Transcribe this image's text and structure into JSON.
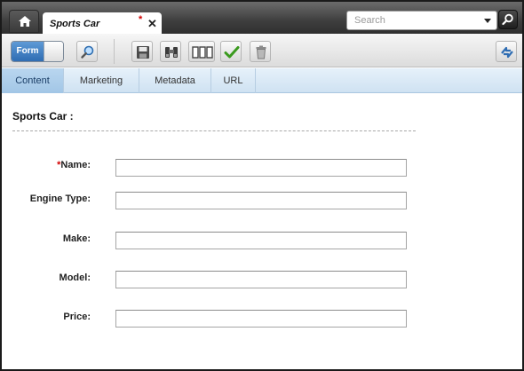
{
  "window": {
    "doc_tab_title": "Sports Car",
    "dirty_marker": "*",
    "close_glyph": "✕"
  },
  "search": {
    "placeholder": "Search",
    "value": ""
  },
  "toolbar": {
    "mode_toggle_label": "Form",
    "buttons": [
      "search-icon",
      "save-icon",
      "compare-icon",
      "columns-icon",
      "checkmark-icon",
      "trash-icon",
      "sync-icon"
    ]
  },
  "tabs": [
    {
      "label": "Content",
      "active": true
    },
    {
      "label": "Marketing",
      "active": false
    },
    {
      "label": "Metadata",
      "active": false
    },
    {
      "label": "URL",
      "active": false
    }
  ],
  "form": {
    "title": "Sports Car :",
    "fields": [
      {
        "required_marker": "*",
        "label": "Name:",
        "value": ""
      },
      {
        "label": "Engine Type:",
        "value": ""
      },
      {
        "label": "Make:",
        "value": ""
      },
      {
        "label": "Model:",
        "value": ""
      },
      {
        "label": "Price:",
        "value": ""
      }
    ]
  },
  "colors": {
    "accent": "#2f6db3",
    "required": "#d40000",
    "tab_bar": "#cfe2f2"
  }
}
